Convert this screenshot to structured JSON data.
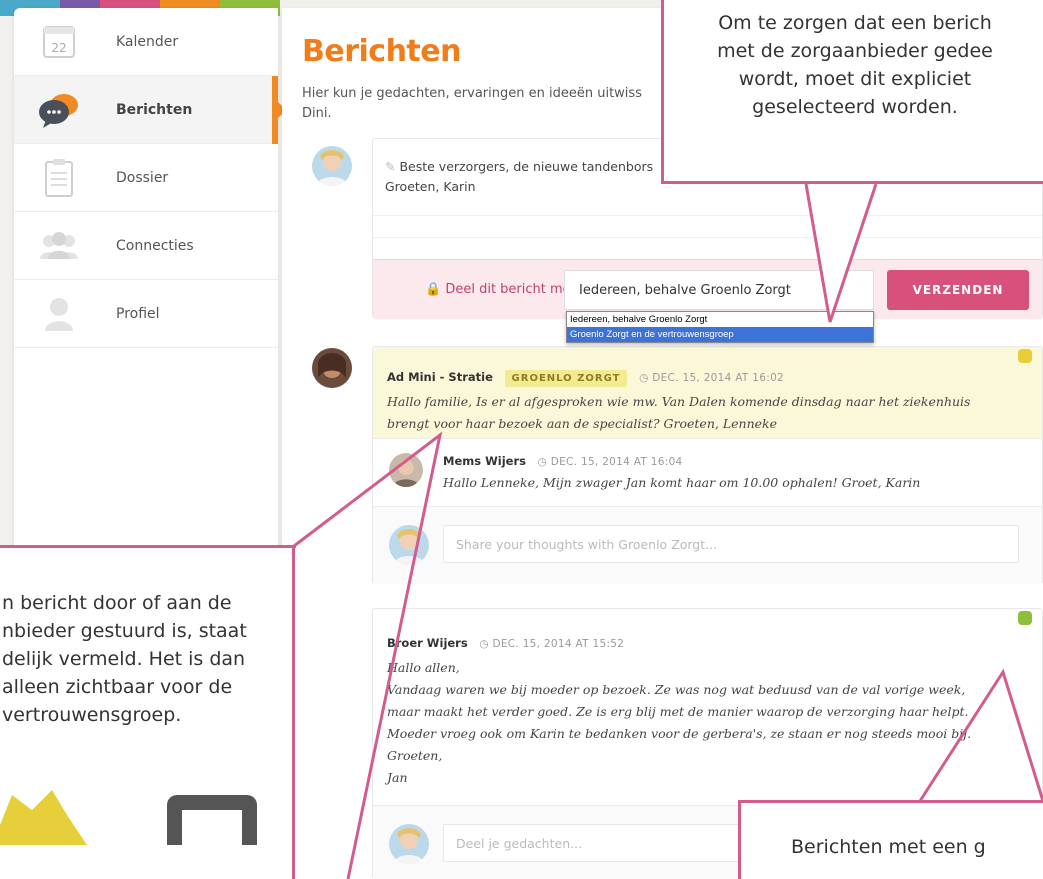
{
  "nav": {
    "items": [
      {
        "label": "Kalender",
        "icon": "calendar-icon",
        "day": "22"
      },
      {
        "label": "Berichten",
        "icon": "chat-bubbles-icon"
      },
      {
        "label": "Dossier",
        "icon": "clipboard-icon"
      },
      {
        "label": "Connecties",
        "icon": "people-icon"
      },
      {
        "label": "Profiel",
        "icon": "person-icon"
      }
    ],
    "active_index": 1
  },
  "main": {
    "title": "Berichten",
    "intro": "Hier kun je gedachten, ervaringen en ideeën uitwiss",
    "intro_line2": "Dini."
  },
  "compose": {
    "text": "Beste verzorgers, de nieuwe tandenbors",
    "text_line2": "Groeten, Karin",
    "share_label": "Deel dit bericht met",
    "share_value": "Iedereen, behalve Groenlo Zorgt",
    "send_label": "VERZENDEN",
    "options": [
      "Iedereen, behalve Groenlo Zorgt",
      "Groenlo Zorgt en de vertrouwensgroep"
    ]
  },
  "posts": [
    {
      "author": "Ad Mini - Stratie",
      "tag": "GROENLO ZORGT",
      "date": "DEC. 15, 2014 AT 16:02",
      "line1": "Hallo familie, Is er al afgesproken wie mw. Van Dalen komende dinsdag naar het ziekenhuis",
      "line2": "brengt voor haar bezoek aan de specialist? Groeten, Lenneke",
      "reply": {
        "author": "Mems Wijers",
        "date": "DEC. 15, 2014 AT 16:04",
        "text": "Hallo Lenneke, Mijn zwager Jan komt haar om 10.00 ophalen! Groet, Karin"
      },
      "reply_placeholder": "Share your thoughts with Groenlo Zorgt..."
    },
    {
      "author": "Broer Wijers",
      "date": "DEC. 15, 2014 AT 15:52",
      "lines": [
        "Hallo allen,",
        "Vandaag waren we bij moeder op bezoek. Ze was nog wat beduusd van de val vorige week,",
        "maar maakt het verder goed. Ze is erg blij met de manier waarop de verzorging haar helpt.",
        "Moeder vroeg ook om Karin te bedanken voor de gerbera's, ze staan er nog steeds mooi bij.",
        "Groeten,",
        "Jan"
      ],
      "reply_placeholder": "Deel je gedachten..."
    }
  ],
  "callouts": {
    "top_right": [
      "Om te zorgen dat een berich",
      "met de zorgaanbieder gedee",
      "wordt, moet dit expliciet",
      "geselecteerd worden."
    ],
    "left": [
      "n bericht door of aan de",
      "nbieder gestuurd is, staat",
      "delijk vermeld. Het is dan",
      "alleen zichtbaar voor de",
      "vertrouwensgroep."
    ],
    "bottom_right": [
      "Berichten met een g"
    ]
  },
  "colors": {
    "accent_orange": "#f07d1a",
    "accent_pink": "#d8517c",
    "callout_border": "#d35c8f",
    "tag_yellow": "#f3ea92",
    "status_yellow": "#e6cf3a",
    "status_green": "#8fbf3a"
  }
}
